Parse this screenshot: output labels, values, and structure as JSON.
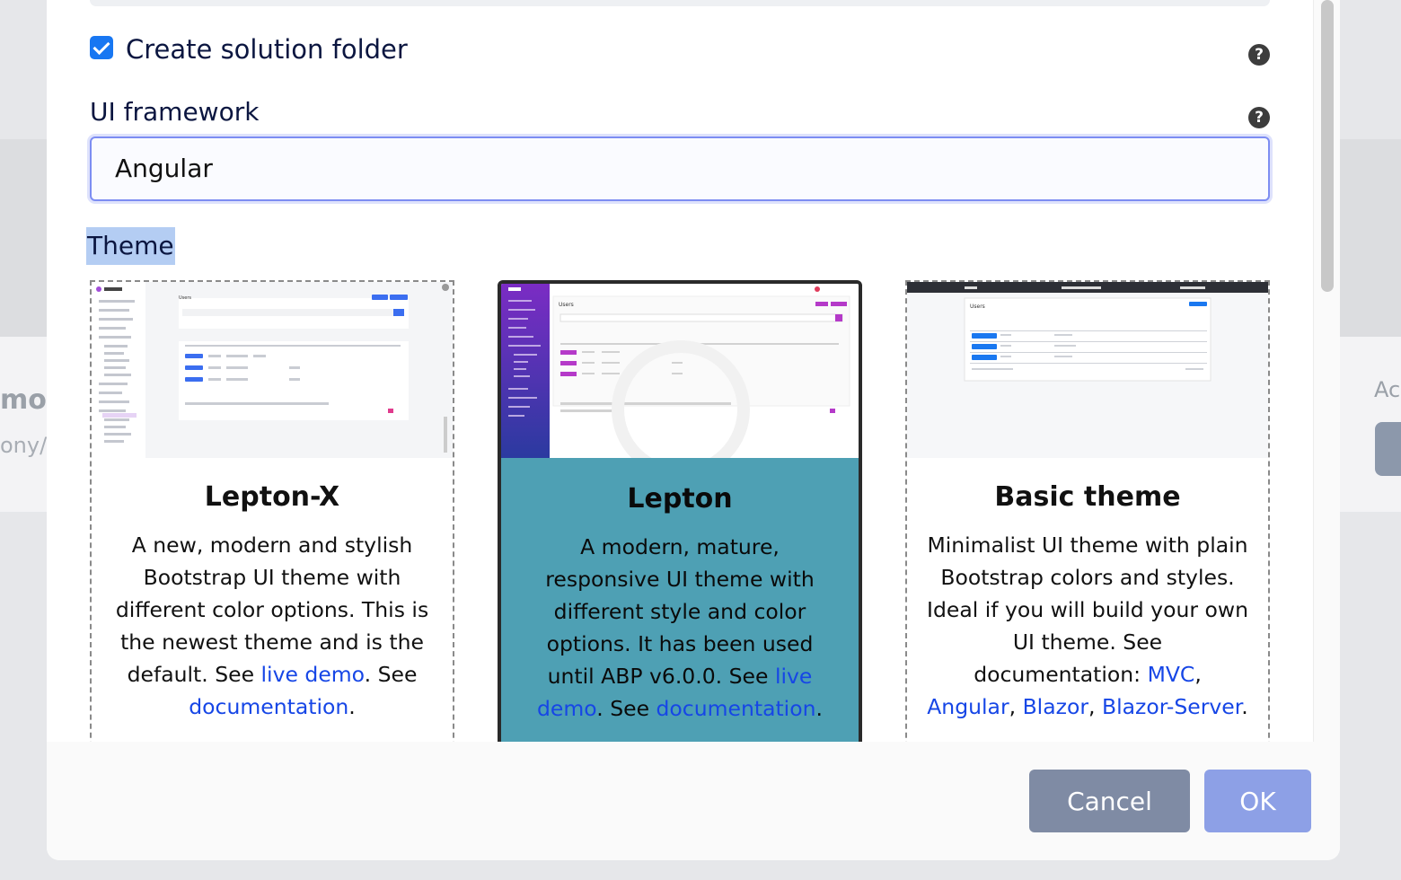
{
  "background": {
    "left_text": "mo",
    "left_subtext": "ony/c",
    "right_text": "Ac"
  },
  "form": {
    "create_folder_label": "Create solution folder",
    "create_folder_checked": true,
    "ui_framework_label": "UI framework",
    "ui_framework_value": "Angular",
    "theme_label": "Theme",
    "help_glyph": "?"
  },
  "themes": [
    {
      "name": "Lepton-X",
      "selected": false,
      "desc_parts": [
        "A new, modern and stylish Bootstrap UI theme with different color options. This is the newest theme and is the default. See ",
        "live demo",
        ". See ",
        "documentation",
        "."
      ],
      "preview": {
        "title": "Users"
      }
    },
    {
      "name": "Lepton",
      "selected": true,
      "desc_parts": [
        "A modern, mature, responsive UI theme with different style and color options. It has been used until ABP v6.0.0. See ",
        "live demo",
        ". See ",
        "documentation",
        "."
      ],
      "preview": {
        "title": "Users"
      }
    },
    {
      "name": "Basic theme",
      "selected": false,
      "desc_parts": [
        "Minimalist UI theme with plain Bootstrap colors and styles. Ideal if you will build your own UI theme. See documentation: ",
        "MVC",
        ", ",
        "Angular",
        ", ",
        "Blazor",
        ", ",
        "Blazor-Server",
        "."
      ],
      "preview": {
        "title": "Users"
      }
    }
  ],
  "buttons": {
    "cancel": "Cancel",
    "ok": "OK"
  },
  "colors": {
    "selected_card": "#4ea0b4",
    "link": "#1646e6",
    "checkbox": "#1877f2",
    "cancel_button": "#7f8ba4",
    "ok_button": "#8da0e6"
  }
}
